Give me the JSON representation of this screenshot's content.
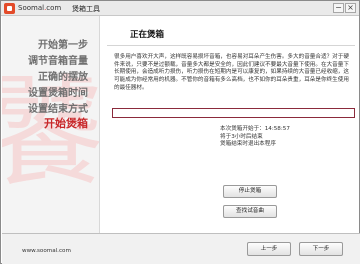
{
  "titlebar": {
    "brand_left": "Soomal",
    "brand_dot": ".",
    "brand_right": "com",
    "title": "煲箱工具",
    "minimize_symbol": "−",
    "close_symbol": "×"
  },
  "sidebar": {
    "watermark_char": "饕",
    "steps": [
      {
        "label": "开始第一步",
        "active": false
      },
      {
        "label": "调节音箱音量",
        "active": false
      },
      {
        "label": "正确的摆放",
        "active": false
      },
      {
        "label": "设置煲箱时间",
        "active": false
      },
      {
        "label": "设置结束方式",
        "active": false
      },
      {
        "label": "开始煲箱",
        "active": true
      }
    ]
  },
  "main": {
    "section_title": "正在煲箱",
    "description": "很多用户喜欢开大声，这样既容易损坏音箱，也容易对耳朵产生伤害。多大的音量合适？对于硬件来说，只要不是过额载，音量多大都是安全的，因此们建议不要最大音量下使用。在大音量下长期使用，会造成听力损伤，听力损伤在短期内是可以康复的，如果持续的大音量已经收缩，这可能成为你经常用的机器。不管你的音箱有多么高档，也不如你的耳朵贵重，耳朵是你终生使用的最佳器材。",
    "progress": 0,
    "status_start": "本次煲箱开始于：14:58:57",
    "status_duration": "将于3小时后结束",
    "status_exit": "煲箱结束时退出本程序",
    "stop_button": "停止煲箱",
    "find_button": "查找试音曲"
  },
  "footer": {
    "site": "www.soomal.com",
    "prev_button": "上一步",
    "next_button": "下一步"
  },
  "colors": {
    "accent": "#c8282a",
    "progress_border": "#8b2a3b"
  }
}
